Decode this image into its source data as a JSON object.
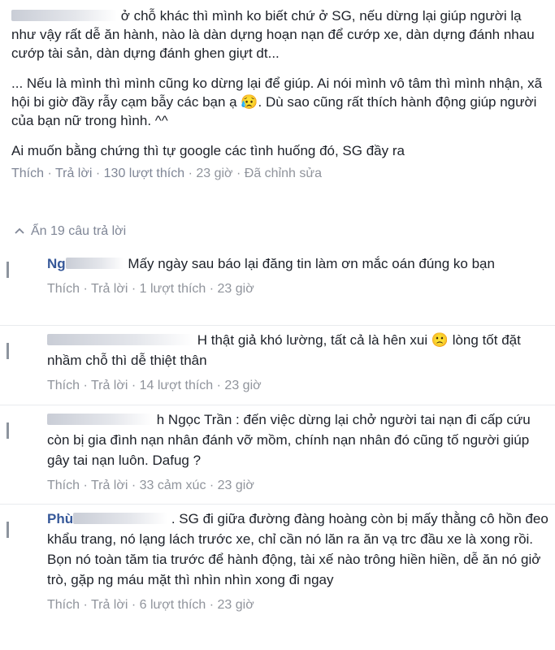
{
  "comment": {
    "para1": "ở chỗ khác thì mình ko biết chứ ở SG, nếu dừng lại giúp người lạ như vậy rất dễ ăn hành, nào là dàn dựng hoạn nạn để cướp xe, dàn dựng đánh nhau cướp tài sản, dàn dựng đánh ghen giựt dt...",
    "para2": "... Nếu là mình thì mình cũng ko dừng lại để giúp. Ai nói mình vô tâm thì mình nhận, xã hội bi giờ đầy rẫy cạm bẫy các bạn ạ 😥. Dù sao cũng rất thích hành động giúp người của bạn nữ trong hình. ^^",
    "para3": "Ai muốn bằng chứng thì tự google các tình huống đó, SG đầy ra",
    "actions": {
      "like": "Thích",
      "reply": "Trả lời",
      "likes": "130 lượt thích",
      "time": "23 giờ",
      "edited": "Đã chỉnh sửa"
    }
  },
  "hide_replies": "Ẩn 19 câu trả lời",
  "replies": [
    {
      "name": "Ng",
      "text": "Mấy ngày sau báo lại đăng tin làm ơn mắc oán đúng ko bạn",
      "like": "Thích",
      "reply": "Trả lời",
      "count": "1 lượt thích",
      "time": "23 giờ"
    },
    {
      "name": "",
      "text": "H thật giả khó lường, tất cả là hên xui 🙁 lòng tốt đặt nhầm chỗ thì dễ thiệt thân",
      "like": "Thích",
      "reply": "Trả lời",
      "count": "14 lượt thích",
      "time": "23 giờ"
    },
    {
      "name": "",
      "text": "h Ngọc Trần : đến việc dừng lại chở người tai nạn đi cấp cứu còn bị gia đình nạn nhân đánh vỡ mồm, chính nạn nhân đó cũng tố người giúp gây tai nạn luôn. Dafug ?",
      "like": "Thích",
      "reply": "Trả lời",
      "count": "33 cảm xúc",
      "time": "23 giờ"
    },
    {
      "name": "Phù",
      "text": ". SG đi giữa đường đàng hoàng còn bị mấy thằng cô hồn đeo khẩu trang, nó lạng lách trước xe, chỉ cần nó lăn ra ăn vạ trc đầu xe là xong rồi. Bọn nó toàn tăm tia trước để hành động, tài xế nào trông hiền hiền, dễ ăn nó giở trò, gặp ng máu mặt thì nhìn nhìn xong đi ngay",
      "like": "Thích",
      "reply": "Trả lời",
      "count": "6 lượt thích",
      "time": "23 giờ"
    }
  ]
}
